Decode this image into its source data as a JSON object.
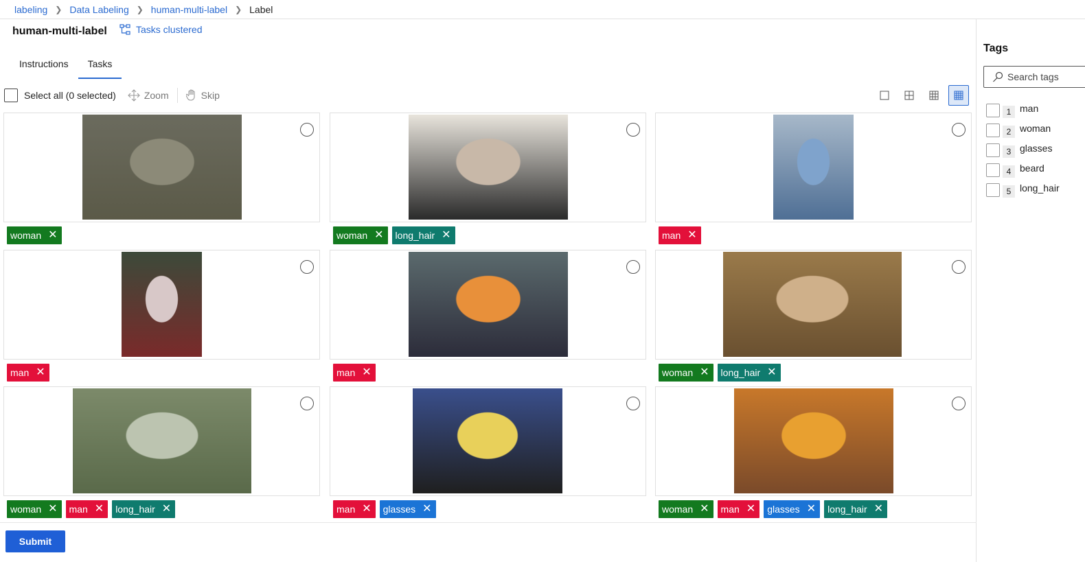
{
  "breadcrumb": [
    "labeling",
    "Data Labeling",
    "human-multi-label",
    "Label"
  ],
  "header": {
    "title": "human-multi-label",
    "cluster_label": "Tasks clustered"
  },
  "tabs": [
    {
      "label": "Instructions",
      "active": false
    },
    {
      "label": "Tasks",
      "active": true
    }
  ],
  "toolbar": {
    "select_all": "Select all (0 selected)",
    "zoom": "Zoom",
    "skip": "Skip",
    "active_view": "grid-3x3"
  },
  "colors": {
    "man": "#e3103a",
    "woman": "#137a1f",
    "long_hair": "#0f7b6e",
    "glasses": "#1b74d6",
    "accent": "#2a6ad0"
  },
  "tasks": [
    {
      "tags": [
        "woman"
      ]
    },
    {
      "tags": [
        "woman",
        "long_hair"
      ]
    },
    {
      "tags": [
        "man"
      ]
    },
    {
      "tags": [
        "man"
      ]
    },
    {
      "tags": [
        "man"
      ]
    },
    {
      "tags": [
        "woman",
        "long_hair"
      ]
    },
    {
      "tags": [
        "woman",
        "man",
        "long_hair"
      ]
    },
    {
      "tags": [
        "man",
        "glasses"
      ]
    },
    {
      "tags": [
        "woman",
        "man",
        "glasses",
        "long_hair"
      ]
    }
  ],
  "submit_label": "Submit",
  "sidebar": {
    "title": "Tags",
    "search_placeholder": "Search tags",
    "tags": [
      {
        "key": "1",
        "label": "man"
      },
      {
        "key": "2",
        "label": "woman"
      },
      {
        "key": "3",
        "label": "glasses"
      },
      {
        "key": "4",
        "label": "beard"
      },
      {
        "key": "5",
        "label": "long_hair"
      }
    ]
  }
}
